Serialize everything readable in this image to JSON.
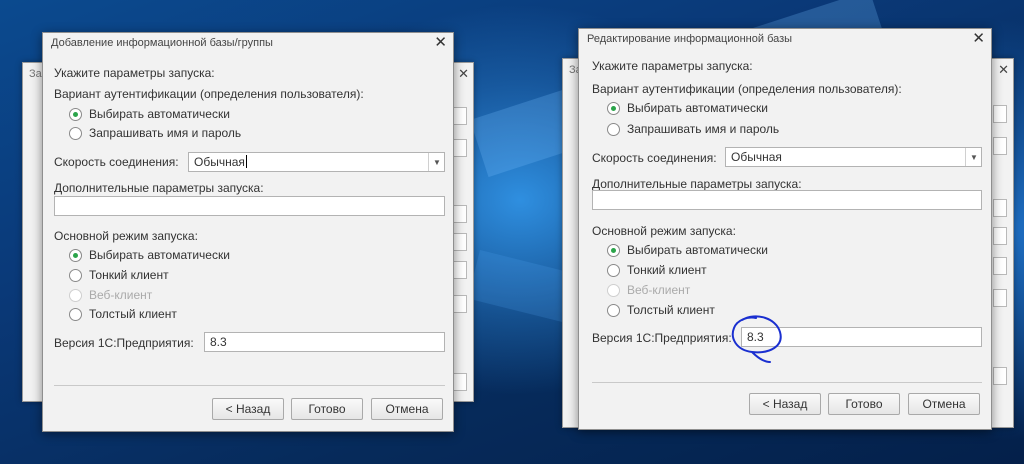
{
  "colors": {
    "accent_radio": "#2ba44a",
    "annotation": "#1a2fd0",
    "dialog_bg": "#f2f2f2",
    "desktop_bg": "#0a3f7e"
  },
  "back_windows": {
    "left_title_fragment": "За",
    "right_title_fragment": "За",
    "close_symbol": "✕"
  },
  "left_dialog": {
    "title": "Добавление информационной базы/группы",
    "close_symbol": "✕",
    "section_label": "Укажите параметры запуска:",
    "auth_label": "Вариант аутентификации (определения пользователя):",
    "auth_options": [
      {
        "label": "Выбирать автоматически",
        "selected": true
      },
      {
        "label": "Запрашивать имя и пароль",
        "selected": false
      }
    ],
    "speed_label": "Скорость соединения:",
    "speed_value": "Обычная",
    "extra_params_label": "Дополнительные параметры запуска:",
    "extra_params_value": "",
    "mode_label": "Основной режим запуска:",
    "mode_options": [
      {
        "label": "Выбирать автоматически",
        "selected": true,
        "disabled": false
      },
      {
        "label": "Тонкий клиент",
        "selected": false,
        "disabled": false
      },
      {
        "label": "Веб-клиент",
        "selected": false,
        "disabled": true
      },
      {
        "label": "Толстый клиент",
        "selected": false,
        "disabled": false
      }
    ],
    "version_label": "Версия 1С:Предприятия:",
    "version_value": "8.3",
    "buttons": {
      "back": "< Назад",
      "done": "Готово",
      "cancel": "Отмена"
    }
  },
  "right_dialog": {
    "title": "Редактирование информационной базы",
    "close_symbol": "✕",
    "section_label": "Укажите параметры запуска:",
    "auth_label": "Вариант аутентификации (определения пользователя):",
    "auth_options": [
      {
        "label": "Выбирать автоматически",
        "selected": true
      },
      {
        "label": "Запрашивать имя и пароль",
        "selected": false
      }
    ],
    "speed_label": "Скорость соединения:",
    "speed_value": "Обычная",
    "extra_params_label": "Дополнительные параметры запуска:",
    "extra_params_value": "",
    "mode_label": "Основной режим запуска:",
    "mode_options": [
      {
        "label": "Выбирать автоматически",
        "selected": true,
        "disabled": false
      },
      {
        "label": "Тонкий клиент",
        "selected": false,
        "disabled": false
      },
      {
        "label": "Веб-клиент",
        "selected": false,
        "disabled": true
      },
      {
        "label": "Толстый клиент",
        "selected": false,
        "disabled": false
      }
    ],
    "version_label": "Версия 1С:Предприятия:",
    "version_value": "8.3",
    "buttons": {
      "back": "< Назад",
      "done": "Готово",
      "cancel": "Отмена"
    }
  }
}
